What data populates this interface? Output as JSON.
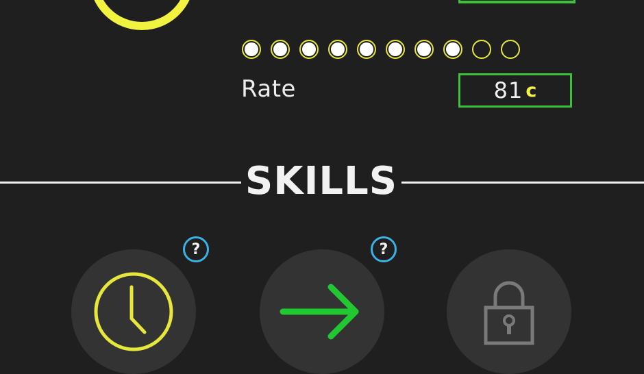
{
  "rate": {
    "label": "Rate",
    "value": "81",
    "currency_symbol": "c",
    "level_filled": 8,
    "level_max": 10
  },
  "skills": {
    "title": "SKILLS",
    "items": [
      {
        "icon": "clock-icon",
        "help": "?",
        "color": "#e6e63c"
      },
      {
        "icon": "arrow-right-icon",
        "help": "?",
        "color": "#22c832"
      },
      {
        "icon": "lock-icon",
        "locked": true,
        "color": "#7a7a7a"
      }
    ]
  },
  "colors": {
    "background": "#1f1f1f",
    "accent_yellow": "#f2f240",
    "accent_green": "#3ec23e",
    "help_blue": "#3ab2e6"
  }
}
